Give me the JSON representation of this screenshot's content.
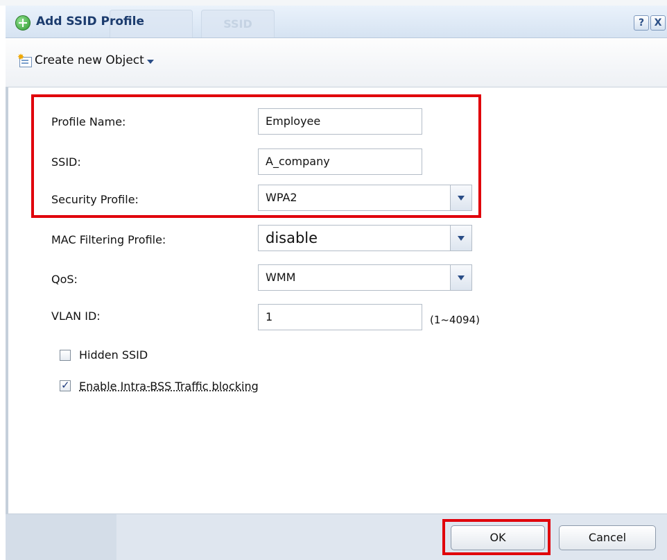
{
  "dialog": {
    "title": "Add SSID Profile",
    "help_label": "?",
    "close_label": "X",
    "ghost_tabs": [
      "",
      "SSID"
    ]
  },
  "toolbar": {
    "create_label": "Create new Object"
  },
  "form": {
    "profile_name_label": "Profile Name:",
    "profile_name_value": "Employee",
    "ssid_label": "SSID:",
    "ssid_value": "A_company",
    "security_label": "Security Profile:",
    "security_value": "WPA2",
    "mac_label": "MAC Filtering Profile:",
    "mac_value": "disable",
    "qos_label": "QoS:",
    "qos_value": "WMM",
    "vlan_label": "VLAN ID:",
    "vlan_value": "1",
    "vlan_hint": "(1~4094)",
    "hidden_ssid_label": "Hidden SSID",
    "hidden_ssid_checked": false,
    "intra_bss_label": "Enable Intra-BSS Traffic blocking",
    "intra_bss_checked": true
  },
  "footer": {
    "ok_label": "OK",
    "cancel_label": "Cancel"
  },
  "colors": {
    "highlight": "#e0000b",
    "title_text": "#1c3c6e"
  }
}
